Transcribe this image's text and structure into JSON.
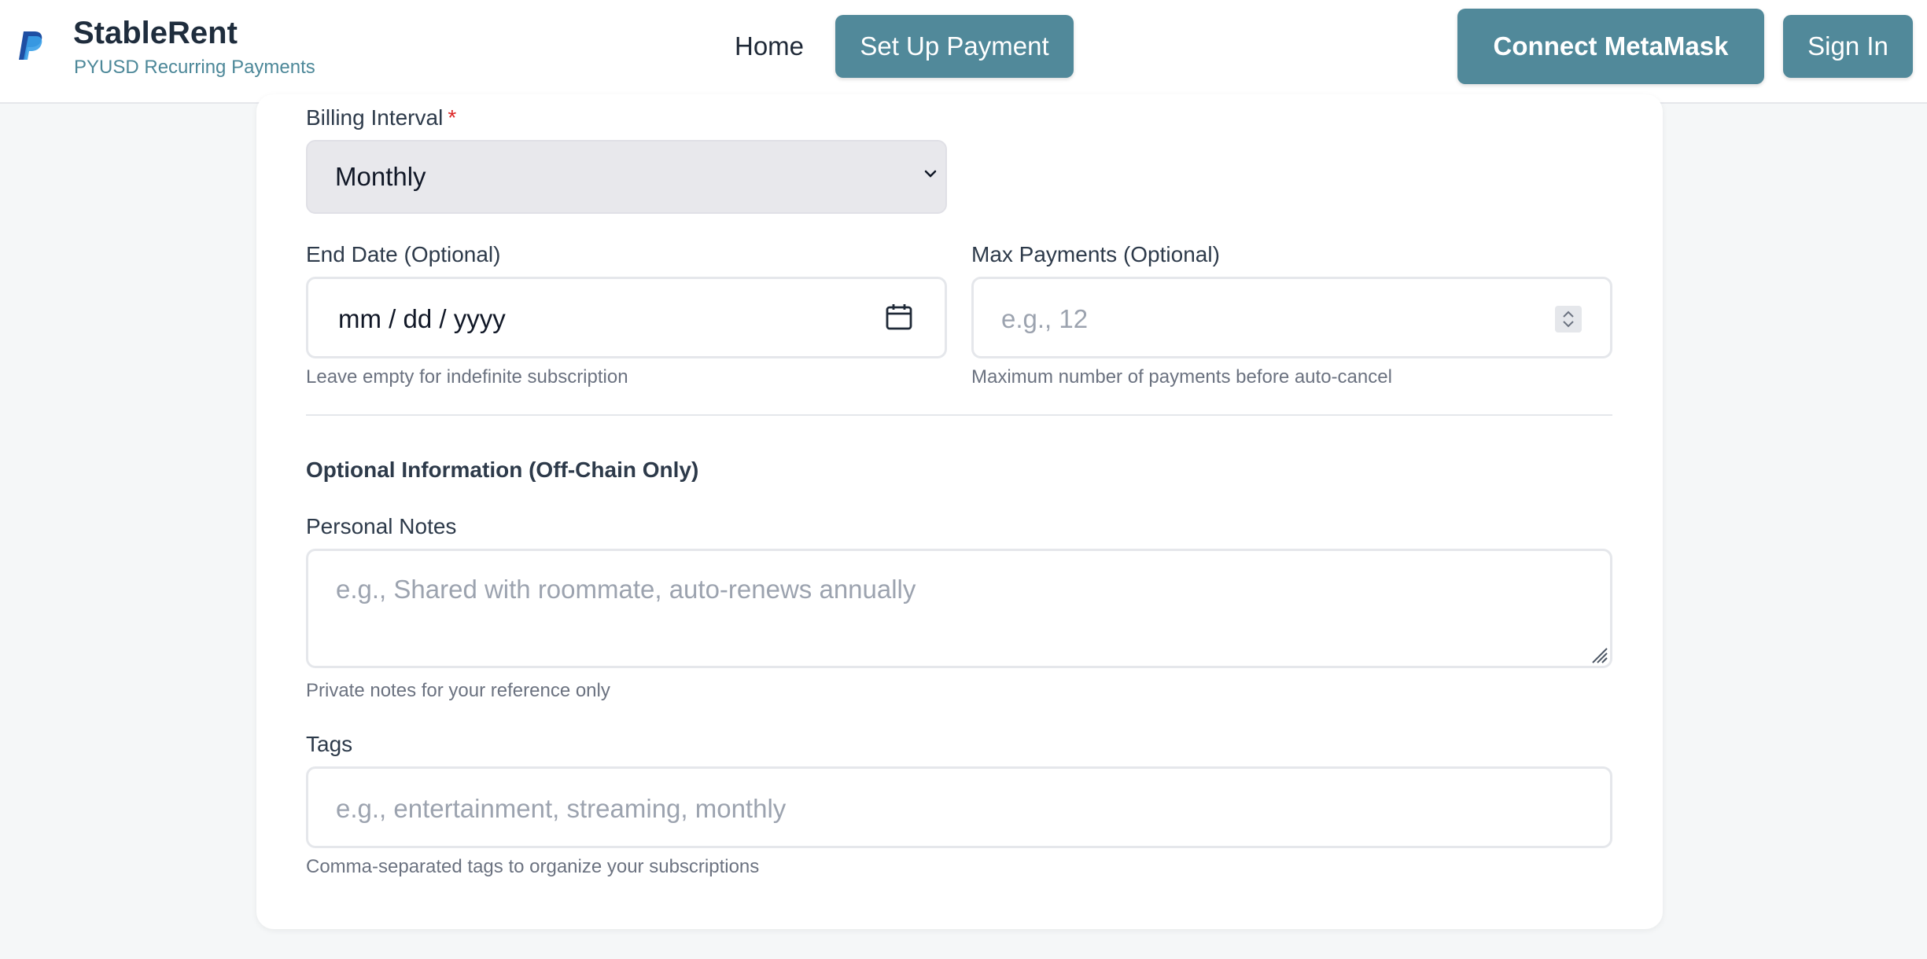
{
  "header": {
    "brand_title": "StableRent",
    "brand_subtitle": "PYUSD Recurring Payments",
    "nav_home": "Home",
    "setup_payment": "Set Up Payment",
    "connect_metamask": "Connect MetaMask",
    "sign_in": "Sign In",
    "logo_icon": "paypal-logo-icon"
  },
  "form": {
    "billing_interval": {
      "label": "Billing Interval",
      "required_mark": "*",
      "value": "Monthly"
    },
    "end_date": {
      "label": "End Date (Optional)",
      "value": "mm / dd / yyyy",
      "hint": "Leave empty for indefinite subscription"
    },
    "max_payments": {
      "label": "Max Payments (Optional)",
      "placeholder": "e.g., 12",
      "hint": "Maximum number of payments before auto-cancel"
    },
    "optional_section_title": "Optional Information (Off-Chain Only)",
    "personal_notes": {
      "label": "Personal Notes",
      "placeholder": "e.g., Shared with roommate, auto-renews annually",
      "hint": "Private notes for your reference only"
    },
    "tags": {
      "label": "Tags",
      "placeholder": "e.g., entertainment, streaming, monthly",
      "hint": "Comma-separated tags to organize your subscriptions"
    }
  },
  "colors": {
    "accent": "#51899a",
    "required": "#dc2626",
    "page_bg": "#f5f7f8"
  }
}
